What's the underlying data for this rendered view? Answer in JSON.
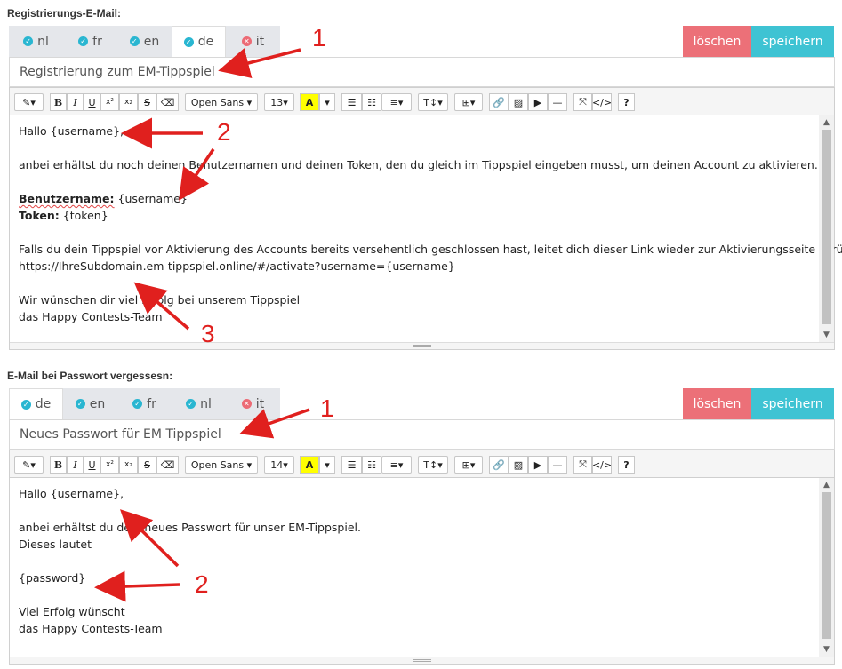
{
  "registration": {
    "label": "Registrierungs-E-Mail:",
    "tabs": [
      {
        "code": "nl",
        "status": "ok"
      },
      {
        "code": "fr",
        "status": "ok"
      },
      {
        "code": "en",
        "status": "ok"
      },
      {
        "code": "de",
        "status": "ok",
        "active": true
      },
      {
        "code": "it",
        "status": "missing"
      }
    ],
    "delete_label": "löschen",
    "save_label": "speichern",
    "subject": "Registrierung zum EM-Tippspiel",
    "toolbar": {
      "font": "Open Sans",
      "size": "13"
    },
    "body": {
      "l1": "Hallo {username},",
      "l2": "anbei erhältst du noch deinen Benutzernamen und deinen Token, den du gleich im Tippspiel eingeben musst, um deinen Account zu aktivieren.",
      "l3_label": "Benutzername:",
      "l3_value": " {username}",
      "l4_label": "Token:",
      "l4_value": " {token}",
      "l5": "Falls du dein Tippspiel vor Aktivierung des Accounts bereits versehentlich geschlossen hast, leitet dich dieser Link wieder zur Aktivierungsseite zurück:",
      "l6": "https://IhreSubdomain.em-tippspiel.online/#/activate?username={username}",
      "l7": "Wir wünschen dir viel Erfolg bei unserem Tippspiel",
      "l8": "das Happy Contests-Team"
    }
  },
  "password": {
    "label": "E-Mail bei Passwort vergessesn:",
    "tabs": [
      {
        "code": "de",
        "status": "ok",
        "active": true
      },
      {
        "code": "en",
        "status": "ok"
      },
      {
        "code": "fr",
        "status": "ok"
      },
      {
        "code": "nl",
        "status": "ok"
      },
      {
        "code": "it",
        "status": "missing"
      }
    ],
    "delete_label": "löschen",
    "save_label": "speichern",
    "subject": "Neues Passwort für EM Tippspiel",
    "toolbar": {
      "font": "Open Sans",
      "size": "14"
    },
    "body": {
      "l1": "Hallo {username},",
      "l2": "anbei erhältst du dein neues Passwort für unser EM-Tippspiel.",
      "l3": "Dieses lautet",
      "l4": "{password}",
      "l5": "Viel Erfolg wünscht",
      "l6": "das Happy Contests-Team"
    }
  },
  "annotations": {
    "a1": "1",
    "a2": "2",
    "a3": "3",
    "b1": "1",
    "b2": "2"
  },
  "colors": {
    "accent_save": "#3ec3d3",
    "accent_delete": "#ec7078",
    "annotation": "#e0201e"
  }
}
